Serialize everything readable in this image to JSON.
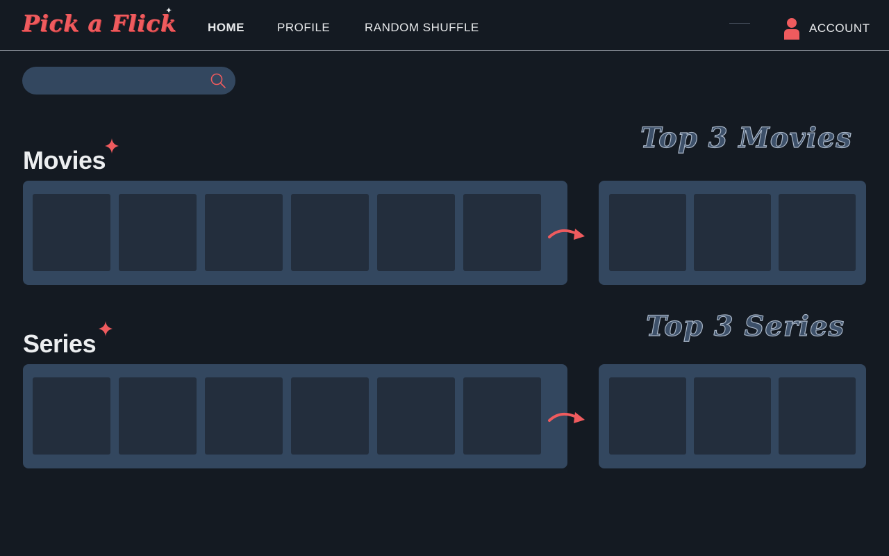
{
  "header": {
    "logo_text": "Pick a Flick",
    "logo_star": "✦",
    "nav": [
      {
        "label": "HOME",
        "active": true
      },
      {
        "label": "PROFILE",
        "active": false
      },
      {
        "label": "RANDOM SHUFFLE",
        "active": false
      }
    ],
    "account_label": "ACCOUNT"
  },
  "search": {
    "value": "",
    "placeholder": ""
  },
  "sections": {
    "movies": {
      "title": "Movies",
      "top_title": "Top 3 Movies",
      "card_count": 6,
      "top_count": 3
    },
    "series": {
      "title": "Series",
      "top_title": "Top 3 Series",
      "card_count": 6,
      "top_count": 3
    }
  },
  "colors": {
    "background": "#141a22",
    "accent": "#ef5b5e",
    "panel": "#33475f",
    "card": "#232e3d",
    "text": "#e6e8ea"
  },
  "icons": {
    "search": "search-icon",
    "account": "user-icon",
    "sparkle": "sparkle-icon",
    "arrow": "curved-arrow-right-icon"
  }
}
